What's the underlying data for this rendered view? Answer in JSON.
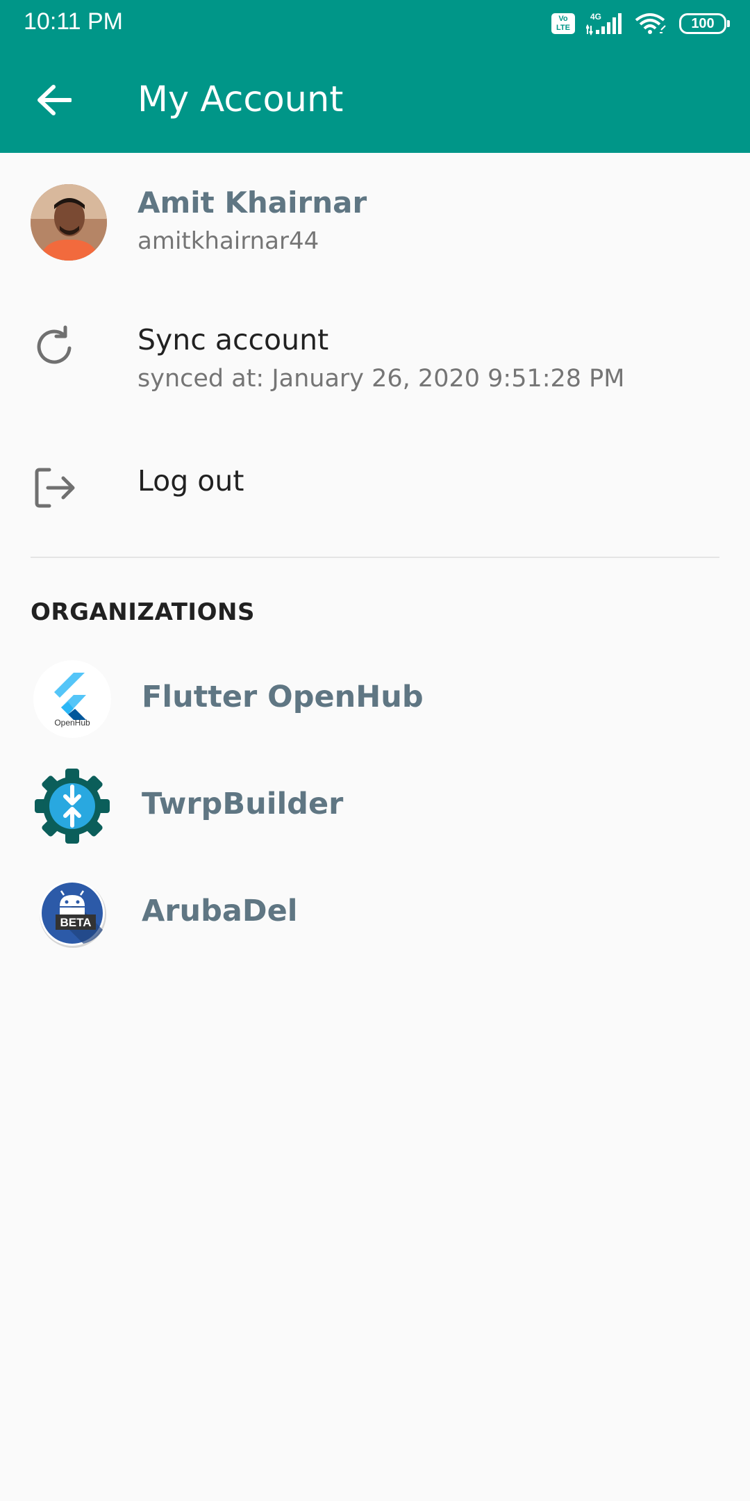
{
  "status_bar": {
    "time": "10:11 PM",
    "network": "4G",
    "volte": "Vo LTE",
    "battery": "100"
  },
  "app_bar": {
    "title": "My Account",
    "back_icon": "arrow-left-icon",
    "color": "#009688"
  },
  "account": {
    "name": "Amit Khairnar",
    "username": "amitkhairnar44"
  },
  "sync": {
    "title": "Sync account",
    "subtitle": "synced at: January 26, 2020 9:51:28 PM",
    "icon": "sync-icon"
  },
  "logout": {
    "title": "Log out",
    "icon": "logout-icon"
  },
  "organizations": {
    "header": "ORGANIZATIONS",
    "items": [
      {
        "name": "Flutter OpenHub",
        "logo_text": "OpenHub",
        "icon": "flutter-openhub-logo-icon"
      },
      {
        "name": "TwrpBuilder",
        "icon": "twrpbuilder-gear-icon"
      },
      {
        "name": "ArubaDel",
        "logo_text": "BETA",
        "icon": "android-beta-icon"
      }
    ]
  }
}
